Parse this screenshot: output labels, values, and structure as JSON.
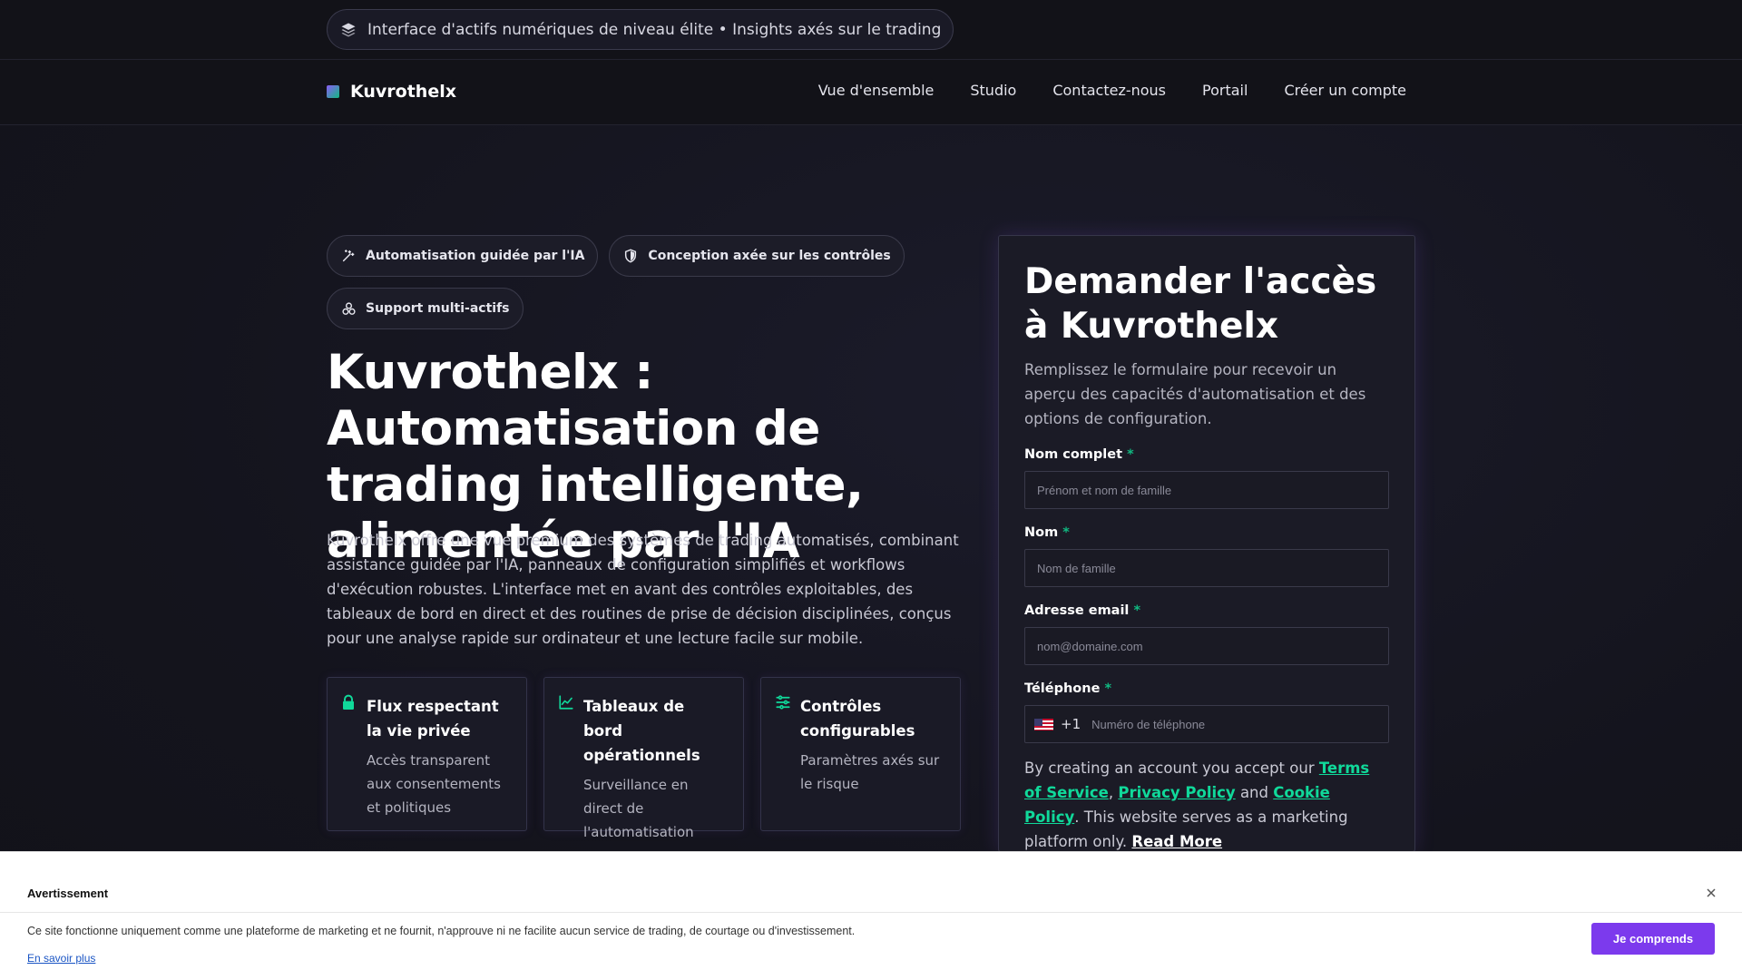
{
  "colors": {
    "accent": "#7c3aed",
    "success": "#10b981",
    "link": "#1a55c4"
  },
  "announcement": {
    "icon": "layers-icon",
    "text": "Interface d'actifs numériques de niveau élite • Insights axés sur le trading"
  },
  "nav": {
    "brand": "Kuvrothelx",
    "items": [
      "Vue d'ensemble",
      "Studio",
      "Contactez-nous",
      "Portail",
      "Créer un compte"
    ]
  },
  "chips": [
    {
      "icon": "magic-wand-icon",
      "label": "Automatisation guidée par l'IA"
    },
    {
      "icon": "shield-icon",
      "label": "Conception axée sur les contrôles"
    },
    {
      "icon": "coins-icon",
      "label": "Support multi-actifs"
    }
  ],
  "hero": {
    "title": "Kuvrothelx : Automatisation de trading intelligente, alimentée par l'IA",
    "lead": "Kuvrothelx offre une vue premium des systèmes de trading automatisés, combinant assistance guidée par l'IA, panneaux de configuration simplifiés et workflows d'exécution robustes. L'interface met en avant des contrôles exploitables, des tableaux de bord en direct et des routines de prise de décision disciplinées, conçus pour une analyse rapide sur ordinateur et une lecture facile sur mobile."
  },
  "features": [
    {
      "icon": "lock-icon",
      "title": "Flux respectant la vie privée",
      "desc": "Accès transparent aux consentements et politiques"
    },
    {
      "icon": "chart-line-icon",
      "title": "Tableaux de bord opérationnels",
      "desc": "Surveillance en direct de l'automatisation"
    },
    {
      "icon": "sliders-icon",
      "title": "Contrôles configurables",
      "desc": "Paramètres axés sur le risque"
    }
  ],
  "form": {
    "title": "Demander l'accès à Kuvrothelx",
    "subtitle": "Remplissez le formulaire pour recevoir un aperçu des capacités d'automatisation et des options de configuration.",
    "required_mark": "*",
    "fields": {
      "fullname": {
        "label": "Nom complet",
        "placeholder": "Prénom et nom de famille",
        "value": ""
      },
      "lastname": {
        "label": "Nom",
        "placeholder": "Nom de famille",
        "value": ""
      },
      "email": {
        "label": "Adresse email",
        "placeholder": "nom@domaine.com",
        "value": ""
      },
      "phone": {
        "label": "Téléphone",
        "country_code": "+1",
        "flag": "us-flag-icon",
        "placeholder": "Numéro de téléphone",
        "value": ""
      }
    },
    "terms": {
      "prefix": "By creating an account you accept our ",
      "tos": "Terms of Service",
      "sep1": ", ",
      "privacy": "Privacy Policy",
      "and": " and ",
      "cookie": "Cookie Policy",
      "middle": ". This website serves as a marketing platform only. ",
      "read_more": "Read More"
    }
  },
  "banner": {
    "title": "Avertissement",
    "close_icon": "close-icon",
    "text": "Ce site fonctionne uniquement comme une plateforme de marketing et ne fournit, n'approuve ni ne facilite aucun service de trading, de courtage ou d'investissement.",
    "more": "En savoir plus",
    "button": "Je comprends"
  }
}
